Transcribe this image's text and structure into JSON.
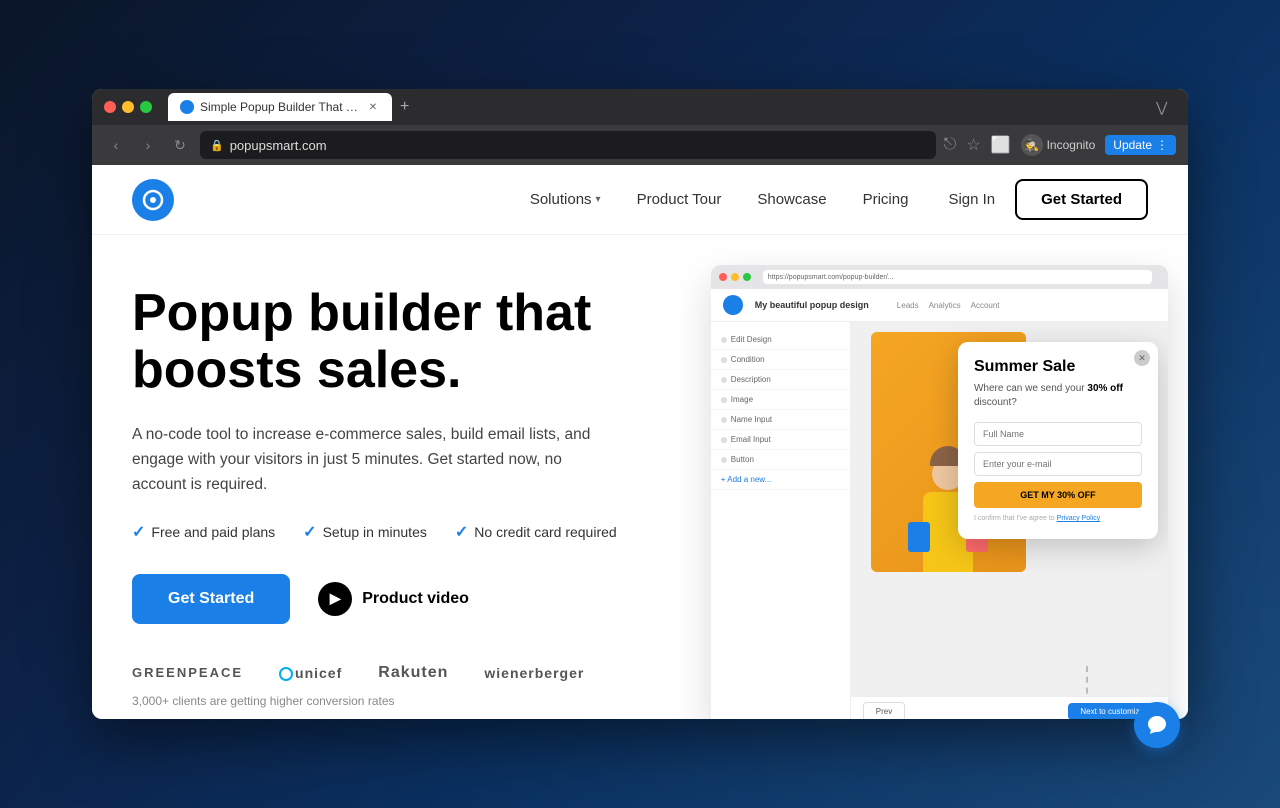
{
  "browser": {
    "tab_title": "Simple Popup Builder That Bo...",
    "url": "popupsmart.com",
    "favicon_color": "#1b7fe8",
    "incognito_label": "Incognito",
    "update_label": "Update"
  },
  "nav": {
    "logo_symbol": "◯",
    "solutions_label": "Solutions",
    "product_tour_label": "Product Tour",
    "showcase_label": "Showcase",
    "pricing_label": "Pricing",
    "sign_in_label": "Sign In",
    "get_started_label": "Get Started"
  },
  "hero": {
    "title_line1": "Popup builder that",
    "title_line2": "boosts sales.",
    "description": "A no-code tool to increase e-commerce sales, build email lists, and engage with your visitors in just 5 minutes. Get started now, no account is required.",
    "check1": "Free and paid plans",
    "check2": "Setup in minutes",
    "check3": "No credit card required",
    "cta_label": "Get Started",
    "video_label": "Product video"
  },
  "clients": {
    "logos": [
      "GREENPEACE",
      "unicef",
      "Rakuten",
      "wienerberger"
    ],
    "tagline": "3,000+ clients are getting higher conversion rates"
  },
  "popup_preview": {
    "title": "Summer Sale",
    "subtitle": "Where can we send your",
    "discount": "30% off",
    "subtitle_end": "discount?",
    "input1_placeholder": "Full Name",
    "input2_placeholder": "Enter your e-mail",
    "cta_label": "GET MY 30% OFF",
    "consent_text": "I confirm that I've agree to",
    "consent_link": "Privacy Policy",
    "url_bar": "https://popupsmart.com/popup-builder/..."
  },
  "preview_sidebar": {
    "items": [
      "Edit Design",
      "Condition",
      "Description",
      "Image",
      "Name Input",
      "Email Input",
      "Button",
      "Add a new..."
    ]
  },
  "preview_nav": {
    "tabs": [
      "Leads",
      "Analytics",
      "Account"
    ]
  },
  "preview_footer": {
    "prev_label": "Prev",
    "next_label": "Next to customize"
  }
}
